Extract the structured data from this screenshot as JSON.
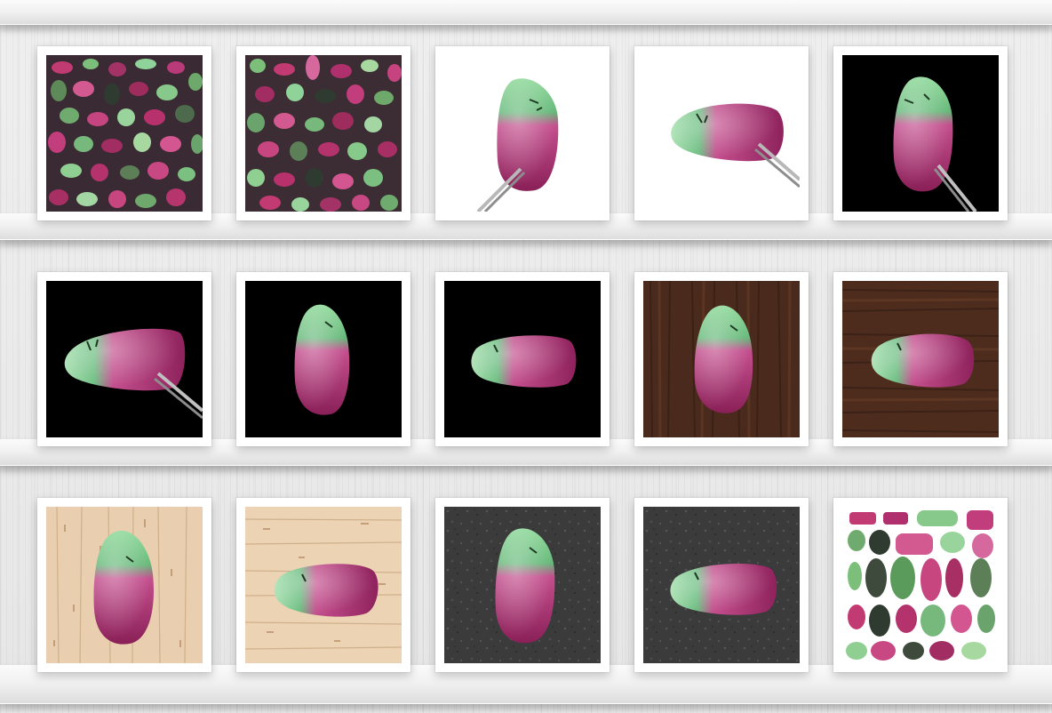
{
  "gallery": {
    "rows": [
      {
        "tiles": [
          {
            "id": "t1",
            "background": "dark-mosaic"
          },
          {
            "id": "t2",
            "background": "dark-mosaic"
          },
          {
            "id": "t3",
            "background": "white",
            "tweezers": true,
            "orientation": "vertical"
          },
          {
            "id": "t4",
            "background": "white",
            "tweezers": true,
            "orientation": "horizontal"
          },
          {
            "id": "t5",
            "background": "black",
            "tweezers": true,
            "orientation": "vertical"
          }
        ]
      },
      {
        "tiles": [
          {
            "id": "t6",
            "background": "black",
            "tweezers": true,
            "orientation": "horizontal"
          },
          {
            "id": "t7",
            "background": "black",
            "tweezers": false,
            "orientation": "vertical"
          },
          {
            "id": "t8",
            "background": "black",
            "tweezers": false,
            "orientation": "horizontal"
          },
          {
            "id": "t9",
            "background": "dark-wood",
            "tweezers": false,
            "orientation": "vertical"
          },
          {
            "id": "t10",
            "background": "dark-wood",
            "tweezers": false,
            "orientation": "horizontal"
          }
        ]
      },
      {
        "tiles": [
          {
            "id": "t11",
            "background": "light-wood",
            "tweezers": false,
            "orientation": "vertical"
          },
          {
            "id": "t12",
            "background": "light-wood",
            "tweezers": false,
            "orientation": "horizontal"
          },
          {
            "id": "t13",
            "background": "slate",
            "tweezers": false,
            "orientation": "vertical"
          },
          {
            "id": "t14",
            "background": "slate",
            "tweezers": false,
            "orientation": "horizontal"
          },
          {
            "id": "t15",
            "background": "white-collection"
          }
        ]
      }
    ]
  },
  "colors": {
    "ruby": "#b0306e",
    "zoisite": "#7fcf8f",
    "shelf": "#f3f3f3",
    "wall": "#e9e9e9"
  }
}
